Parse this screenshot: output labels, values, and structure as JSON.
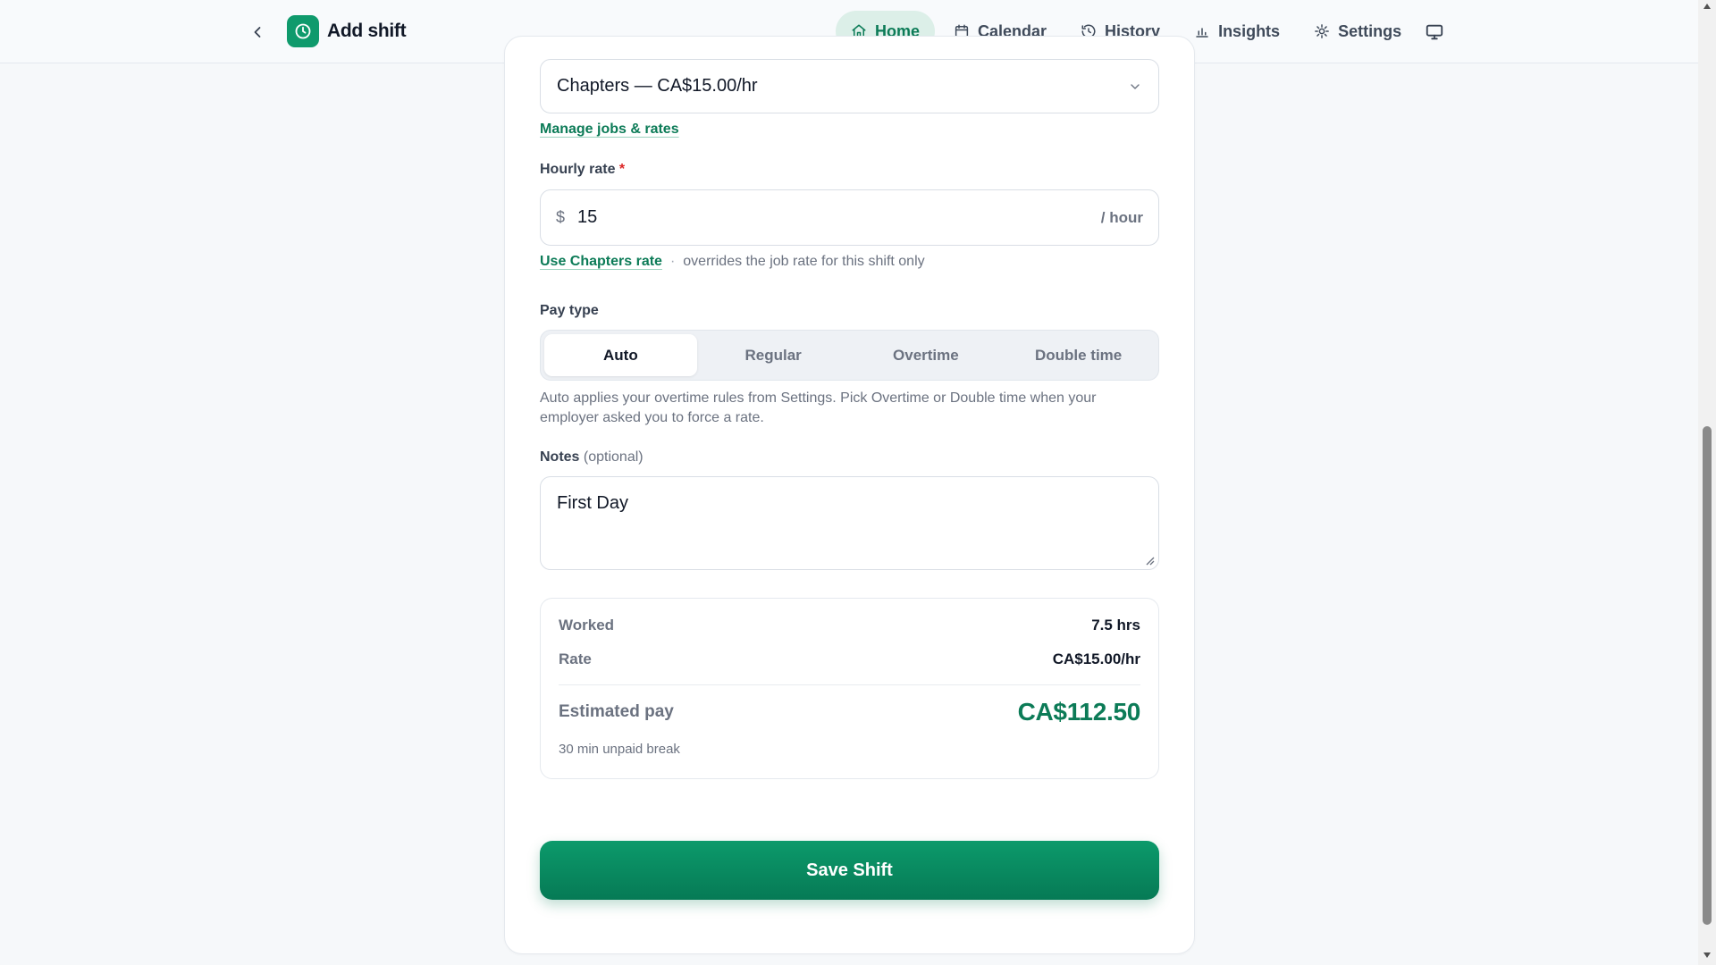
{
  "header": {
    "title": "Add shift",
    "nav": [
      {
        "label": "Home",
        "icon": "home-icon",
        "active": true
      },
      {
        "label": "Calendar",
        "icon": "calendar-icon",
        "active": false
      },
      {
        "label": "History",
        "icon": "history-icon",
        "active": false
      },
      {
        "label": "Insights",
        "icon": "insights-icon",
        "active": false
      },
      {
        "label": "Settings",
        "icon": "settings-icon",
        "active": false
      }
    ]
  },
  "job": {
    "selected": "Chapters — CA$15.00/hr",
    "manage_link": "Manage jobs & rates"
  },
  "rate": {
    "label": "Hourly rate",
    "required_marker": "*",
    "prefix": "$",
    "value": "15",
    "suffix": "/ hour",
    "use_link": "Use Chapters rate",
    "separator": "·",
    "note": "overrides the job rate for this shift only"
  },
  "pay_type": {
    "label": "Pay type",
    "options": [
      "Auto",
      "Regular",
      "Overtime",
      "Double time"
    ],
    "selected": "Auto",
    "help": "Auto applies your overtime rules from Settings. Pick Overtime or Double time when your employer asked you to force a rate."
  },
  "notes": {
    "label": "Notes",
    "optional": "(optional)",
    "value": "First Day"
  },
  "summary": {
    "worked_label": "Worked",
    "worked_value": "7.5 hrs",
    "rate_label": "Rate",
    "rate_value": "CA$15.00/hr",
    "estimated_label": "Estimated pay",
    "estimated_value": "CA$112.50",
    "break_note": "30 min unpaid break"
  },
  "actions": {
    "save_label": "Save Shift"
  },
  "colors": {
    "accent": "#0c7b57",
    "accent_bg": "#dcefe8",
    "required": "#dc2626"
  }
}
